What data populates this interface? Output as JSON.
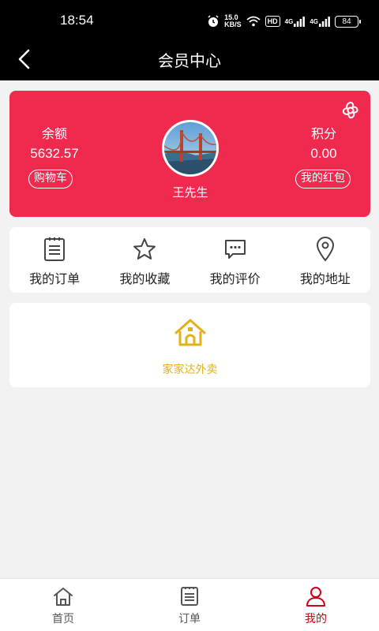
{
  "status_bar": {
    "time": "18:54",
    "speed_value": "15.0",
    "speed_unit": "KB/S",
    "hd": "HD",
    "net_a": "4G",
    "net_b": "4G",
    "battery": "84"
  },
  "header": {
    "title": "会员中心",
    "back_icon": "chevron-left-icon"
  },
  "member": {
    "balance_label": "余额",
    "balance_value": "5632.57",
    "points_label": "积分",
    "points_value": "0.00",
    "cart_button": "购物车",
    "redpacket_button": "我的红包",
    "username": "王先生",
    "card_color": "#f0294f"
  },
  "quick_menu": [
    {
      "label": "我的订单",
      "icon": "order-list-icon"
    },
    {
      "label": "我的收藏",
      "icon": "star-icon"
    },
    {
      "label": "我的评价",
      "icon": "comment-icon"
    },
    {
      "label": "我的地址",
      "icon": "location-pin-icon"
    }
  ],
  "service": {
    "label": "家家达外卖",
    "icon": "house-icon",
    "accent": "#e2b21c"
  },
  "bottom_nav": [
    {
      "label": "首页",
      "icon": "home-icon"
    },
    {
      "label": "订单",
      "icon": "order-icon"
    },
    {
      "label": "我的",
      "icon": "user-icon",
      "active": true
    }
  ],
  "active_color": "#d0021b"
}
